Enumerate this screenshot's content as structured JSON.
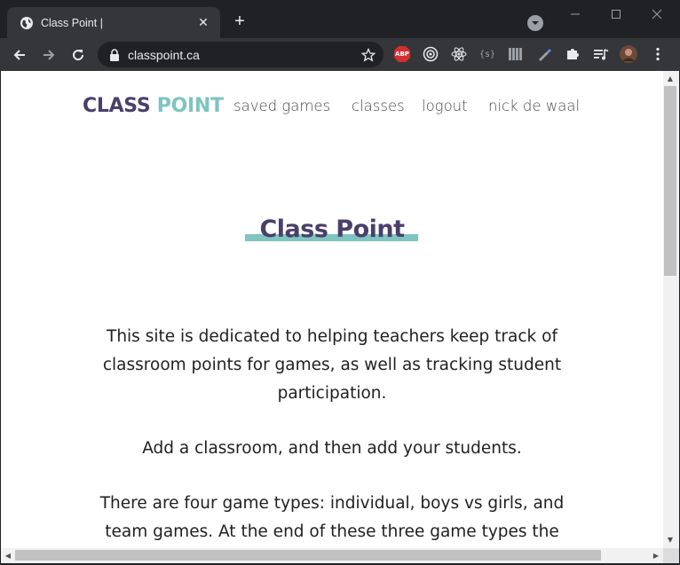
{
  "browser": {
    "tab_title": "Class Point |",
    "url": "classpoint.ca",
    "new_tab_label": "+",
    "tab_close_label": "✕",
    "extensions": [
      "abp-icon",
      "target-icon",
      "react-icon",
      "brackets-icon",
      "bars-icon",
      "pen-icon",
      "puzzle-icon",
      "media-icon",
      "avatar"
    ],
    "abp_text": "ABP",
    "brackets_text": "{s}"
  },
  "site": {
    "logo_part1": "CLASS",
    "logo_part2": "POINT",
    "nav": [
      {
        "label": "saved games"
      },
      {
        "label": "classes"
      },
      {
        "label": "logout"
      },
      {
        "label": "nick de waal"
      }
    ],
    "hero_title": "Class Point",
    "paragraphs": [
      "This site is dedicated to helping teachers keep track of classroom points for games, as well as tracking student participation.",
      "Add a classroom, and then add your students.",
      "There are four game types: individual, boys vs girls, and team games. At the end of these three game types the"
    ]
  },
  "colors": {
    "brand_primary": "#4a3f6b",
    "brand_accent": "#7ec4c1",
    "chrome_dark": "#202124",
    "chrome_toolbar": "#35363a"
  }
}
